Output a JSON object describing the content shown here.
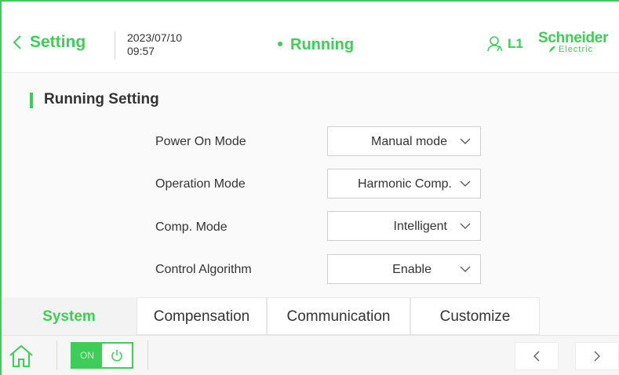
{
  "header": {
    "back_label": "Setting",
    "date": "2023/07/10",
    "time": "09:57",
    "status": "Running",
    "user_level": "L1",
    "brand_line1": "Schneider",
    "brand_line2": "Electric"
  },
  "section": {
    "title": "Running Setting"
  },
  "settings": [
    {
      "label": "Power On Mode",
      "value": "Manual mode"
    },
    {
      "label": "Operation Mode",
      "value": "Harmonic Comp."
    },
    {
      "label": "Comp. Mode",
      "value": "Intelligent"
    },
    {
      "label": "Control Algorithm",
      "value": "Enable"
    }
  ],
  "tabs": [
    {
      "label": "System",
      "active": true
    },
    {
      "label": "Compensation",
      "active": false
    },
    {
      "label": "Communication",
      "active": false
    },
    {
      "label": "Customize",
      "active": false
    }
  ],
  "bottom": {
    "power_state": "ON"
  },
  "colors": {
    "accent": "#3dcd58",
    "text": "#333333",
    "border": "#cfcfcf"
  },
  "icons": [
    "chevron-left-icon",
    "user-icon",
    "chevron-down-icon",
    "home-icon",
    "power-icon",
    "chevron-right-icon"
  ]
}
